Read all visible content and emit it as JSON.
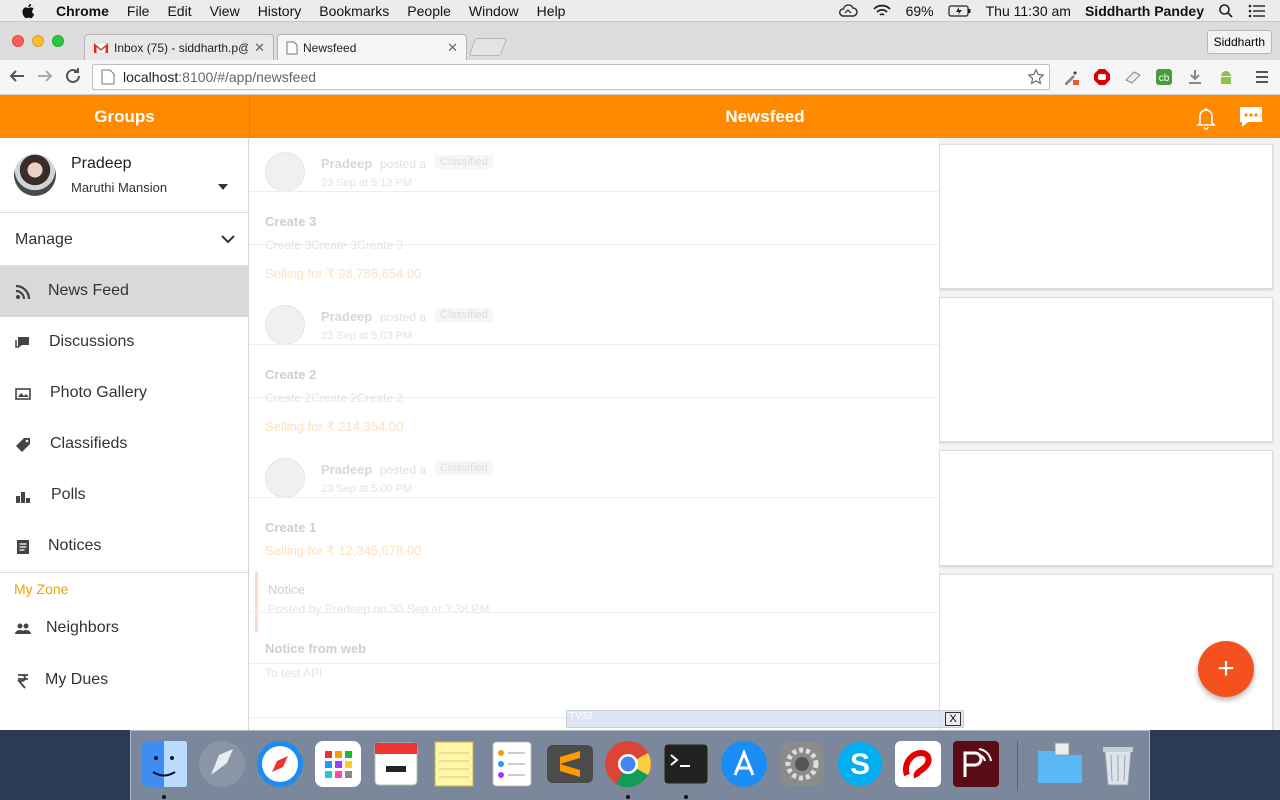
{
  "menubar": {
    "app_name": "Chrome",
    "items": [
      "File",
      "Edit",
      "View",
      "History",
      "Bookmarks",
      "People",
      "Window",
      "Help"
    ],
    "battery": "69%",
    "clock": "Thu 11:30 am",
    "user": "Siddharth Pandey"
  },
  "browser": {
    "tabs": [
      {
        "label": "Inbox (75) - siddharth.p@c",
        "active": false
      },
      {
        "label": "Newsfeed",
        "active": true
      }
    ],
    "profile_button": "Siddharth",
    "url_host": "localhost",
    "url_path": ":8100/#/app/newsfeed"
  },
  "app": {
    "groups_title": "Groups",
    "newsfeed_title": "Newsfeed",
    "profile": {
      "name": "Pradeep",
      "building": "Maruthi Mansion"
    },
    "manage_label": "Manage",
    "nav_items": [
      {
        "label": "News Feed",
        "icon": "rss-icon",
        "active": true
      },
      {
        "label": "Discussions",
        "icon": "discussion-icon",
        "active": false
      },
      {
        "label": "Photo Gallery",
        "icon": "gallery-icon",
        "active": false
      },
      {
        "label": "Classifieds",
        "icon": "tag-icon",
        "active": false
      },
      {
        "label": "Polls",
        "icon": "poll-icon",
        "active": false
      },
      {
        "label": "Notices",
        "icon": "notice-icon",
        "active": false
      }
    ],
    "my_zone_title": "My Zone",
    "zone_items": [
      {
        "label": "Neighbors",
        "icon": "neighbors-icon"
      },
      {
        "label": "My Dues",
        "icon": "rupee-icon"
      }
    ],
    "posts": [
      {
        "author": "Pradeep",
        "verb": "posted a",
        "badge": "Classified",
        "time": "23 Sep at 5:12 PM",
        "title": "Create 3",
        "body": "Create 3Create 3Create 3",
        "price": "Selling for ₹ 98,786,654.00"
      },
      {
        "author": "Pradeep",
        "verb": "posted a",
        "badge": "Classified",
        "time": "23 Sep at 5:03 PM",
        "title": "Create 2",
        "body": "Create 2Create 2Create 2",
        "price": "Selling for ₹ 214,354.00"
      },
      {
        "author": "Pradeep",
        "verb": "posted a",
        "badge": "Classified",
        "time": "23 Sep at 5:00 PM",
        "title": "Create 1",
        "price": "Selling for ₹ 12,345,678.00"
      }
    ],
    "notice": {
      "title": "Notice",
      "posted_by": "Posted by Pradeep on 30 Sep at 3:38 PM",
      "heading": "Notice from web",
      "body": "To test API"
    },
    "fab_label": "+",
    "tv_label": "TV32",
    "tv_close": "X"
  },
  "colors": {
    "accent": "#ff8a00",
    "fab": "#f4511e",
    "zone": "#f5a000"
  }
}
